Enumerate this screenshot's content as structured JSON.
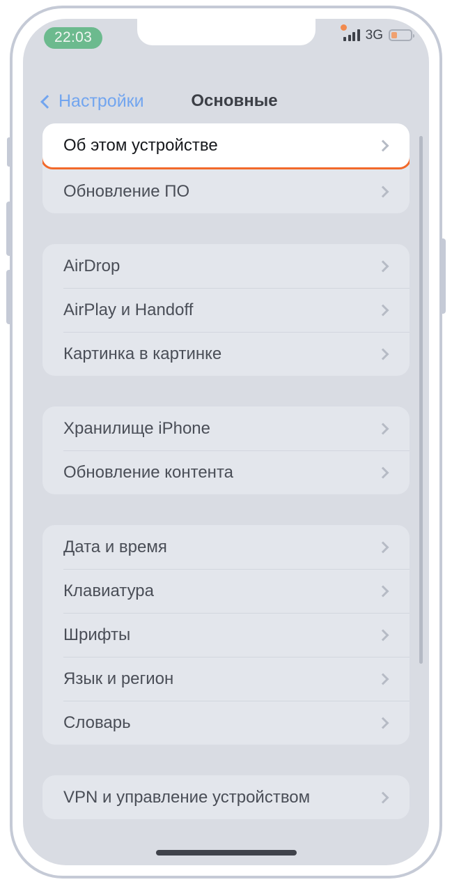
{
  "status_bar": {
    "time": "22:03",
    "network": "3G",
    "recording_indicator": "recording-dot-icon",
    "signal_icon": "signal-bars-icon",
    "battery_icon": "battery-icon",
    "battery_level_percent": 32
  },
  "nav_bar": {
    "back_label": "Настройки",
    "back_icon": "chevron-left-icon",
    "title": "Основные"
  },
  "colors": {
    "accent_highlight": "#f2692a",
    "link_blue": "#72a5ef",
    "time_pill_green": "#6cba8e",
    "battery_orange": "#f0a170",
    "screen_background": "#d9dce3",
    "group_background": "#e3e6ec"
  },
  "groups": [
    {
      "rows": [
        {
          "label": "Об этом устройстве",
          "highlighted": true
        },
        {
          "label": "Обновление ПО",
          "highlighted": false
        }
      ]
    },
    {
      "rows": [
        {
          "label": "AirDrop",
          "highlighted": false
        },
        {
          "label": "AirPlay и Handoff",
          "highlighted": false
        },
        {
          "label": "Картинка в картинке",
          "highlighted": false
        }
      ]
    },
    {
      "rows": [
        {
          "label": "Хранилище iPhone",
          "highlighted": false
        },
        {
          "label": "Обновление контента",
          "highlighted": false
        }
      ]
    },
    {
      "rows": [
        {
          "label": "Дата и время",
          "highlighted": false
        },
        {
          "label": "Клавиатура",
          "highlighted": false
        },
        {
          "label": "Шрифты",
          "highlighted": false
        },
        {
          "label": "Язык и регион",
          "highlighted": false
        },
        {
          "label": "Словарь",
          "highlighted": false
        }
      ]
    },
    {
      "rows": [
        {
          "label": "VPN и управление устройством",
          "highlighted": false
        }
      ]
    }
  ]
}
